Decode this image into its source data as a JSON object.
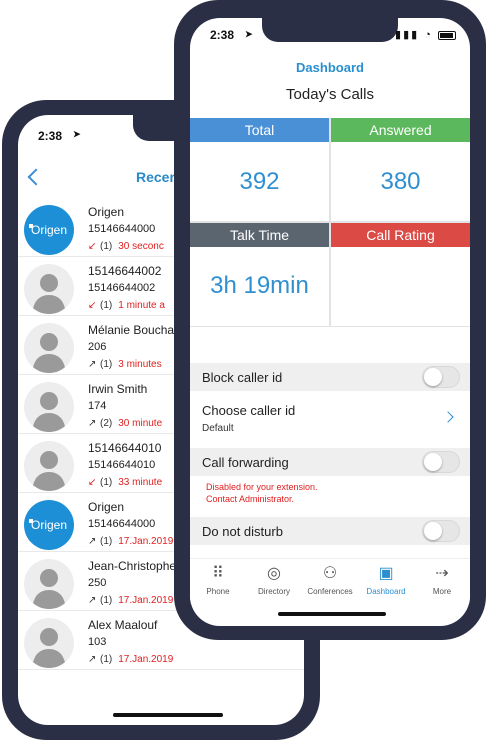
{
  "back_phone": {
    "status_time": "2:38",
    "header_title": "Recen",
    "recents": [
      {
        "name": "Origen",
        "number": "15146644000",
        "direction": "missed",
        "count": "(1)",
        "time": "30 seconc",
        "avatar": "origen"
      },
      {
        "name": "15146644002",
        "number": "15146644002",
        "direction": "missed",
        "count": "(1)",
        "time": "1 minute a",
        "avatar": "placeholder"
      },
      {
        "name": "Mélanie Boucha",
        "number": "206",
        "direction": "outgoing",
        "count": "(1)",
        "time": "3 minutes",
        "avatar": "person"
      },
      {
        "name": "Irwin Smith",
        "number": "174",
        "direction": "outgoing",
        "count": "(2)",
        "time": "30 minute",
        "avatar": "person"
      },
      {
        "name": "15146644010",
        "number": "15146644010",
        "direction": "missed",
        "count": "(1)",
        "time": "33 minute",
        "avatar": "placeholder"
      },
      {
        "name": "Origen",
        "number": "15146644000",
        "direction": "outgoing",
        "count": "(1)",
        "time": "17.Jan.2019",
        "avatar": "origen"
      },
      {
        "name": "Jean-Christophe",
        "number": "250",
        "direction": "outgoing",
        "count": "(1)",
        "time": "17.Jan.2019",
        "avatar": "person"
      },
      {
        "name": "Alex Maalouf",
        "number": "103",
        "direction": "outgoing",
        "count": "(1)",
        "time": "17.Jan.2019",
        "avatar": "placeholder"
      }
    ],
    "origen_logo_text": "Origen"
  },
  "front_phone": {
    "status_time": "2:38",
    "title": "Dashboard",
    "subtitle": "Today's Calls",
    "tiles": {
      "total_label": "Total",
      "total_value": "392",
      "answered_label": "Answered",
      "answered_value": "380",
      "talk_label": "Talk Time",
      "talk_value": "3h 19min",
      "rating_label": "Call Rating",
      "rating_value": ""
    },
    "colors": {
      "total": "#4a90d6",
      "answered": "#5bb85c",
      "talk": "#5b6570",
      "rating": "#dc4a45",
      "accent": "#2b8fcf",
      "warning": "#e02020"
    },
    "settings": {
      "block_caller_id": {
        "label": "Block caller id",
        "on": false
      },
      "choose_caller_id": {
        "label": "Choose caller id",
        "value": "Default"
      },
      "call_forwarding": {
        "label": "Call forwarding",
        "on": false,
        "warning_line1": "Disabled for your extension.",
        "warning_line2": "Contact Administrator."
      },
      "do_not_disturb": {
        "label": "Do not disturb",
        "on": false
      }
    },
    "tabs": [
      {
        "label": "Phone",
        "icon": "keypad-icon"
      },
      {
        "label": "Directory",
        "icon": "contact-icon"
      },
      {
        "label": "Conferences",
        "icon": "group-icon"
      },
      {
        "label": "Dashboard",
        "icon": "chart-icon",
        "active": true
      },
      {
        "label": "More",
        "icon": "arrow-more-icon"
      }
    ]
  }
}
